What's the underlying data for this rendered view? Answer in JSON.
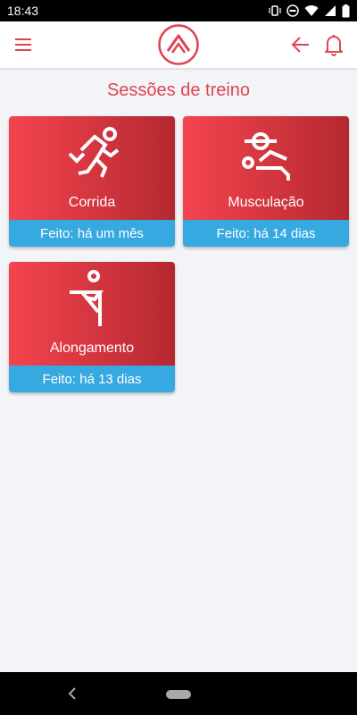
{
  "status_bar": {
    "time": "18:43"
  },
  "header": {
    "menu_icon": "hamburger-icon",
    "logo_icon": "app-logo-chevron",
    "back_icon": "arrow-left-icon",
    "bell_icon": "bell-icon",
    "accent_color": "#e04451"
  },
  "page": {
    "title": "Sessões de treino"
  },
  "sessions": [
    {
      "label": "Corrida",
      "status": "Feito: há um mês",
      "icon": "running-icon"
    },
    {
      "label": "Musculação",
      "status": "Feito: há 14 dias",
      "icon": "weightlifting-icon"
    },
    {
      "label": "Alongamento",
      "status": "Feito: há 13 dias",
      "icon": "stretching-icon"
    }
  ],
  "colors": {
    "card_gradient_start": "#f4444f",
    "card_gradient_end": "#b52830",
    "status_strip": "#36a9e1",
    "background": "#f3f4f8"
  }
}
